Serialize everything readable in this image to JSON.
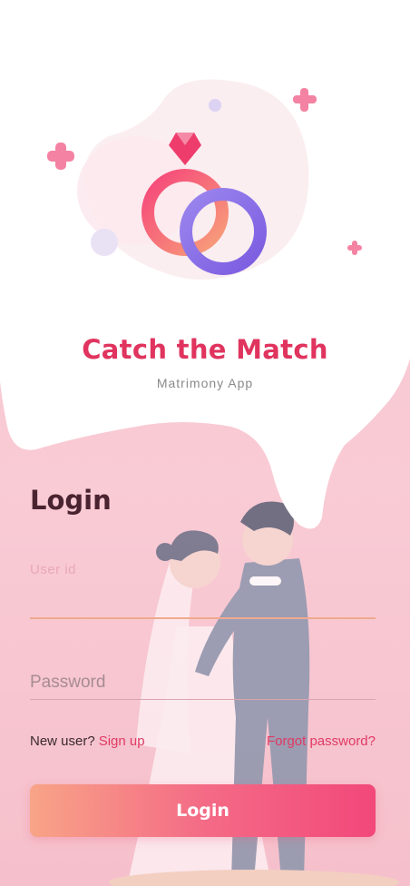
{
  "app": {
    "title": "Catch the Match",
    "subtitle": "Matrimony App"
  },
  "login": {
    "heading": "Login",
    "userid_label": "User id",
    "userid_value": "",
    "password_placeholder": "Password",
    "password_value": "",
    "new_user_text": "New user?",
    "signup_link": "Sign up",
    "forgot_link": "Forgot password?",
    "button_label": "Login"
  },
  "colors": {
    "brand": "#e0345f",
    "background": "#f7c9d2",
    "button_start": "#f8a487",
    "button_end": "#f2487a"
  },
  "icons": [
    "rings-logo-icon",
    "sparkle-icon",
    "couple-illustration"
  ]
}
